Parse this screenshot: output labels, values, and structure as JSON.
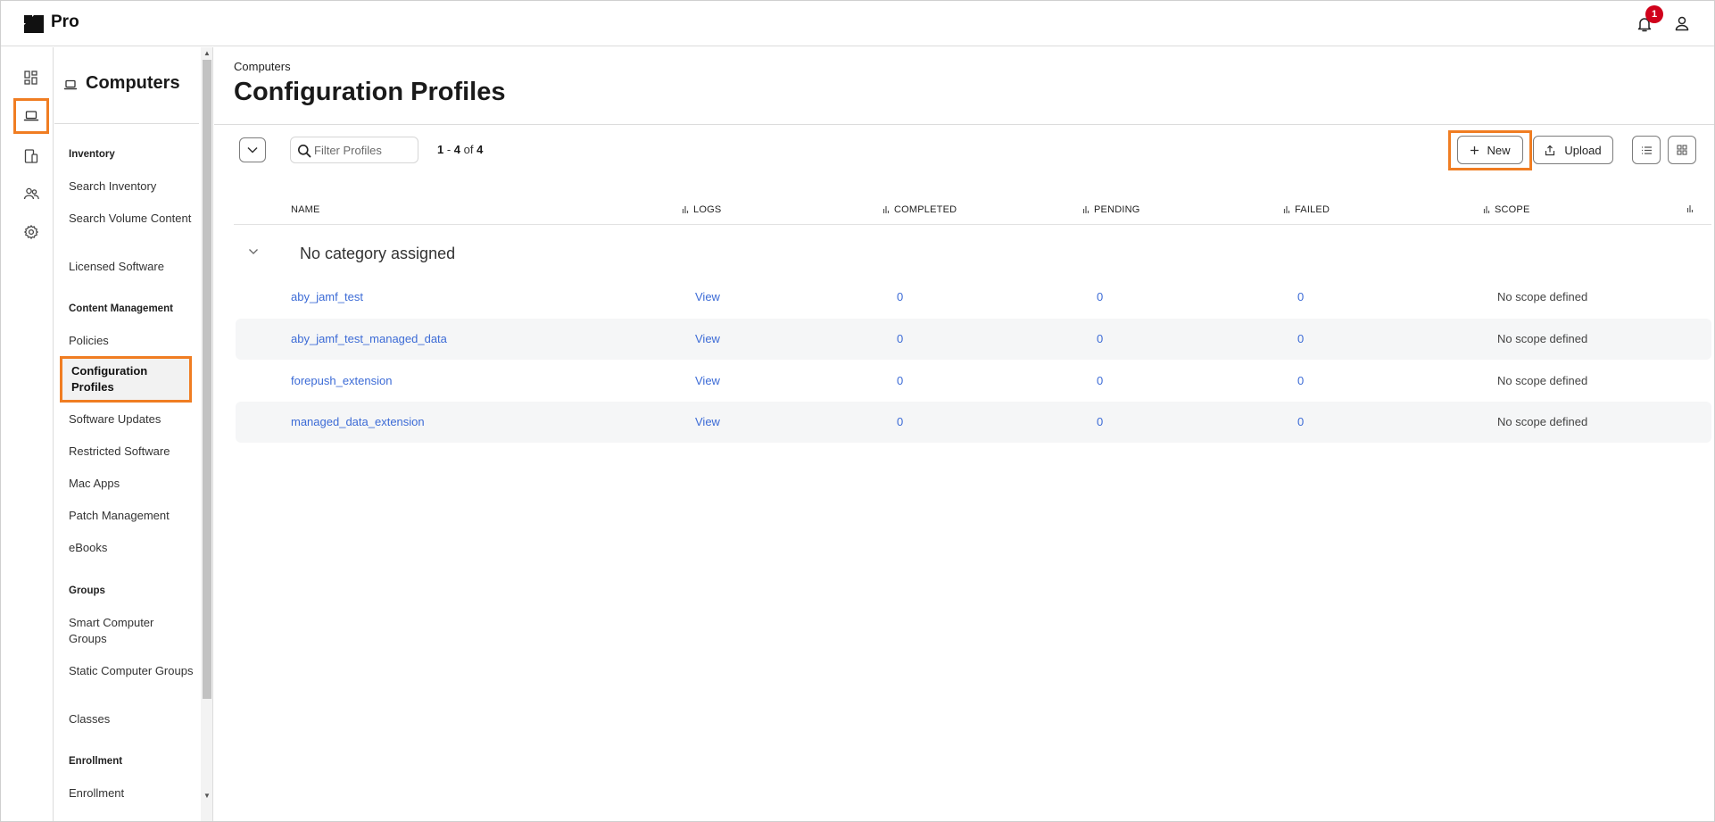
{
  "app": {
    "title": "Pro",
    "notifications": "1"
  },
  "sidebar": {
    "title": "Computers",
    "sections": [
      {
        "label": "Inventory",
        "items": [
          "Search Inventory",
          "Search Volume Content",
          "Licensed Software"
        ]
      },
      {
        "label": "Content Management",
        "items": [
          "Policies",
          "Configuration Profiles",
          "Software Updates",
          "Restricted Software",
          "Mac Apps",
          "Patch Management",
          "eBooks"
        ]
      },
      {
        "label": "Groups",
        "items": [
          "Smart Computer Groups",
          "Static Computer Groups",
          "Classes"
        ]
      },
      {
        "label": "Enrollment",
        "items": [
          "Enrollment"
        ]
      }
    ]
  },
  "main": {
    "breadcrumb": "Computers",
    "title": "Configuration Profiles",
    "filter_placeholder": "Filter Profiles",
    "pager": {
      "from": "1",
      "to": "4",
      "of_label": "of",
      "total": "4"
    },
    "new_label": "New",
    "upload_label": "Upload"
  },
  "table": {
    "columns": [
      "NAME",
      "LOGS",
      "COMPLETED",
      "PENDING",
      "FAILED",
      "SCOPE"
    ],
    "group_label": "No category assigned",
    "rows": [
      {
        "name": "aby_jamf_test",
        "logs": "View",
        "completed": "0",
        "pending": "0",
        "failed": "0",
        "scope": "No scope defined"
      },
      {
        "name": "aby_jamf_test_managed_data",
        "logs": "View",
        "completed": "0",
        "pending": "0",
        "failed": "0",
        "scope": "No scope defined"
      },
      {
        "name": "forepush_extension",
        "logs": "View",
        "completed": "0",
        "pending": "0",
        "failed": "0",
        "scope": "No scope defined"
      },
      {
        "name": "managed_data_extension",
        "logs": "View",
        "completed": "0",
        "pending": "0",
        "failed": "0",
        "scope": "No scope defined"
      }
    ]
  },
  "colors": {
    "highlight": "#f07d22",
    "link": "#3c6bd6",
    "badge": "#d0021b"
  }
}
